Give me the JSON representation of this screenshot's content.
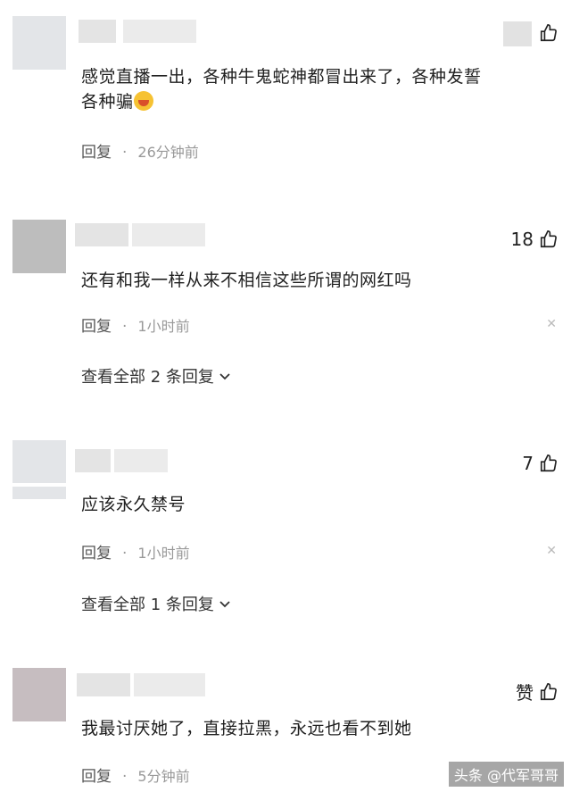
{
  "comments": [
    {
      "text_line1": "感觉直播一出，各种牛鬼蛇神都冒出来了，各种发誓",
      "text_line2": "各种骗",
      "reply_label": "回复",
      "time": "26分钟前",
      "likes": ""
    },
    {
      "text_line1": "还有和我一样从来不相信这些所谓的网红吗",
      "reply_label": "回复",
      "time": "1小时前",
      "likes": "18",
      "expand_label": "查看全部 2 条回复"
    },
    {
      "text_line1": "应该永久禁号",
      "reply_label": "回复",
      "time": "1小时前",
      "likes": "7",
      "expand_label": "查看全部 1 条回复"
    },
    {
      "text_line1": "我最讨厌她了，直接拉黑，永远也看不到她",
      "reply_label": "回复",
      "time": "5分钟前",
      "likes": "赞"
    }
  ],
  "watermark": "头条 @代军哥哥",
  "icons": {
    "like": "thumbs-up-icon",
    "close": "close-icon",
    "chevron": "chevron-down-icon"
  }
}
